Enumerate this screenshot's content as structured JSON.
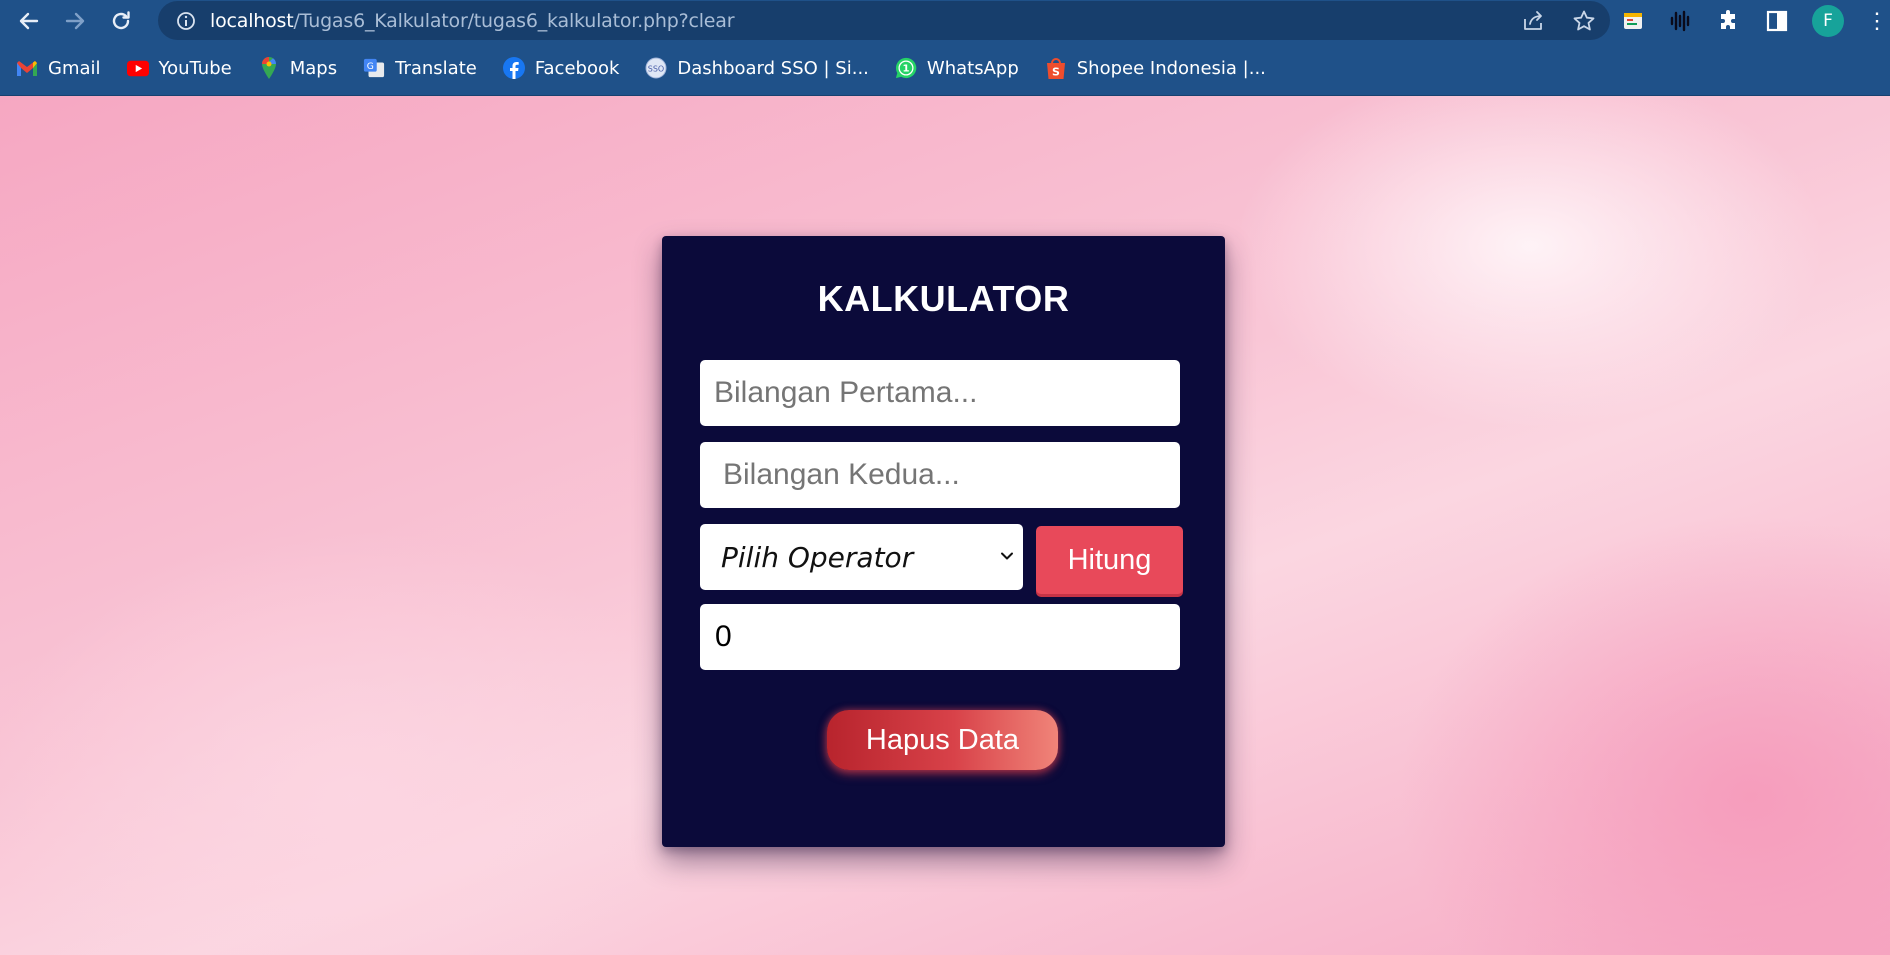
{
  "browser": {
    "url_host": "localhost",
    "url_path": "/Tugas6_Kalkulator/tugas6_kalkulator.php?clear",
    "profile_initial": "F",
    "bookmarks": [
      {
        "label": "Gmail",
        "icon": "gmail-icon"
      },
      {
        "label": "YouTube",
        "icon": "youtube-icon"
      },
      {
        "label": "Maps",
        "icon": "maps-icon"
      },
      {
        "label": "Translate",
        "icon": "translate-icon"
      },
      {
        "label": "Facebook",
        "icon": "facebook-icon"
      },
      {
        "label": "Dashboard SSO | Si...",
        "icon": "sso-icon"
      },
      {
        "label": "WhatsApp",
        "icon": "whatsapp-icon"
      },
      {
        "label": "Shopee Indonesia |...",
        "icon": "shopee-icon"
      }
    ]
  },
  "calculator": {
    "title": "KALKULATOR",
    "first_placeholder": "Bilangan Pertama...",
    "second_placeholder": "Bilangan Kedua...",
    "operator_selected": "Pilih Operator",
    "calculate_label": "Hitung",
    "result_value": "0",
    "clear_label": "Hapus Data"
  },
  "colors": {
    "chrome_bg": "#1f5189",
    "card_bg": "#0b0a3a",
    "accent_red": "#e8495a",
    "page_pink": "#f7b3c9"
  }
}
